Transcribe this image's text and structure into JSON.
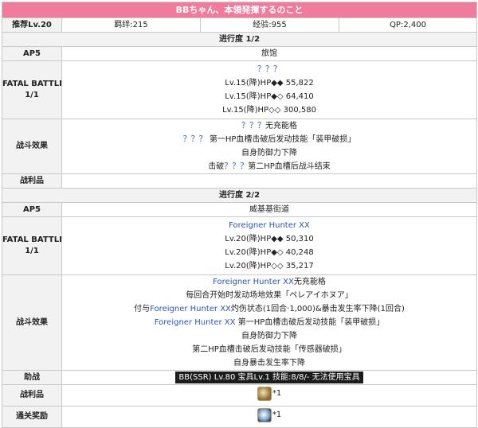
{
  "title": "BBちゃん、本領発揮するのこと",
  "info": {
    "recommend": "推荐Lv.20",
    "bond": "羁绊:215",
    "exp": "经验:955",
    "qp": "QP:2,400"
  },
  "stage1": {
    "header": "进行度 1/2",
    "ap_label": "AP5",
    "location": "旅馆",
    "fatal_label": "FATAL BATTLE",
    "fatal_count": "1/1",
    "enemy_name": "？？？",
    "enemy_lines": [
      "Lv.15(降)HP◆◆ 55,822",
      "Lv.15(降)HP◆◇ 64,410",
      "Lv.15(降)HP◇◇ 300,580"
    ],
    "effect_label": "战斗效果",
    "effects": [
      {
        "pre": "",
        "blue": "？？？",
        "post": "无充能格"
      },
      {
        "pre": "",
        "blue": "？？？",
        "post": " 第一HP血槽击破后发动技能「装甲破损」"
      },
      {
        "pre": "自身防御力下降",
        "blue": "",
        "post": ""
      },
      {
        "pre": "击破",
        "blue": "？？？",
        "post": "第二HP血槽后战斗结束"
      }
    ],
    "loot_label": "战利品"
  },
  "stage2": {
    "header": "进行度 2/2",
    "ap_label": "AP5",
    "location": "威基基街道",
    "fatal_label": "FATAL BATTLE",
    "fatal_count": "1/1",
    "enemy_name": "Foreigner Hunter XX",
    "enemy_lines": [
      "Lv.20(降)HP◆◆ 50,310",
      "Lv.20(降)HP◆◇ 40,248",
      "Lv.20(降)HP◇◇ 35,217"
    ],
    "effect_label": "战斗效果",
    "effects": [
      {
        "pre": "",
        "blue": "Foreigner Hunter XX",
        "post": "无充能格"
      },
      {
        "pre": "每回合开始时发动场地效果「ペレアイホヌア」",
        "blue": "",
        "post": ""
      },
      {
        "pre": "付与",
        "blue": "Foreigner Hunter XX",
        "post": "灼伤状态(1回合·1,000)&暴击发生率下降(1回合)"
      },
      {
        "pre": "",
        "blue": "Foreigner Hunter XX",
        "post": " 第一HP血槽击破后发动技能「装甲破损」"
      },
      {
        "pre": "自身防御力下降",
        "blue": "",
        "post": ""
      },
      {
        "pre": "第二HP血槽击破后发动技能「传感器破损」",
        "blue": "",
        "post": ""
      },
      {
        "pre": "自身暴击发生率下降",
        "blue": "",
        "post": ""
      }
    ],
    "support_label": "助战",
    "support_text": "BB(SSR) Lv.80 宝具Lv.1 技能:8/8/- 无法使用宝具",
    "loot_label": "战利品",
    "loot_qty": "*1",
    "clear_label": "通关奖励",
    "clear_qty": "*1"
  },
  "colors": {
    "title_bg": "#f07b9c",
    "label_bg": "#f2f2f2",
    "link_blue": "#2b55b8"
  }
}
